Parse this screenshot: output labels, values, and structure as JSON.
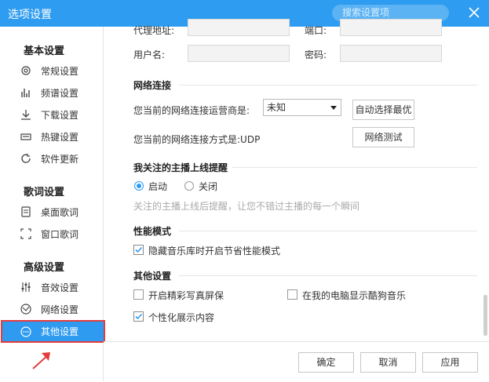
{
  "window": {
    "title": "选项设置",
    "search_placeholder": "搜索设置项"
  },
  "sidebar": {
    "groups": [
      {
        "label": "基本设置"
      },
      {
        "label": "歌词设置"
      },
      {
        "label": "高级设置"
      }
    ],
    "items": [
      {
        "label": "常规设置",
        "icon": "gear-icon"
      },
      {
        "label": "频谱设置",
        "icon": "spectrum-icon"
      },
      {
        "label": "下载设置",
        "icon": "download-icon"
      },
      {
        "label": "热键设置",
        "icon": "keyboard-icon"
      },
      {
        "label": "软件更新",
        "icon": "update-icon"
      },
      {
        "label": "桌面歌词",
        "icon": "desktop-lyrics-icon"
      },
      {
        "label": "窗口歌词",
        "icon": "window-lyrics-icon"
      },
      {
        "label": "音效设置",
        "icon": "equalizer-icon"
      },
      {
        "label": "网络设置",
        "icon": "network-icon"
      },
      {
        "label": "其他设置",
        "icon": "more-icon",
        "active": true
      }
    ]
  },
  "proxy": {
    "address_label": "代理地址:",
    "port_label": "端口:",
    "username_label": "用户名:",
    "password_label": "密码:",
    "address_value": "",
    "port_value": "",
    "username_value": "",
    "password_value": ""
  },
  "network": {
    "section_title": "网络连接",
    "carrier_label": "您当前的网络连接运营商是:",
    "carrier_value": "未知",
    "auto_select_button": "自动选择最优",
    "method_label": "您当前的网络连接方式是:UDP",
    "test_button": "网络测试"
  },
  "reminder": {
    "section_title": "我关注的主播上线提醒",
    "on_label": "启动",
    "off_label": "关闭",
    "selected": "启动",
    "hint": "关注的主播上线后提醒，让您不错过主播的每一个瞬间"
  },
  "performance": {
    "section_title": "性能模式",
    "option_label": "隐藏音乐库时开启节省性能模式",
    "checked": true
  },
  "other": {
    "section_title": "其他设置",
    "options": [
      {
        "label": "开启精彩写真屏保",
        "checked": false
      },
      {
        "label": "在我的电脑显示酷狗音乐",
        "checked": false
      },
      {
        "label": "个性化展示内容",
        "checked": true
      }
    ]
  },
  "footer": {
    "ok": "确定",
    "cancel": "取消",
    "apply": "应用"
  },
  "colors": {
    "accent": "#2e9cf0",
    "highlight_border": "#e43c3c"
  }
}
